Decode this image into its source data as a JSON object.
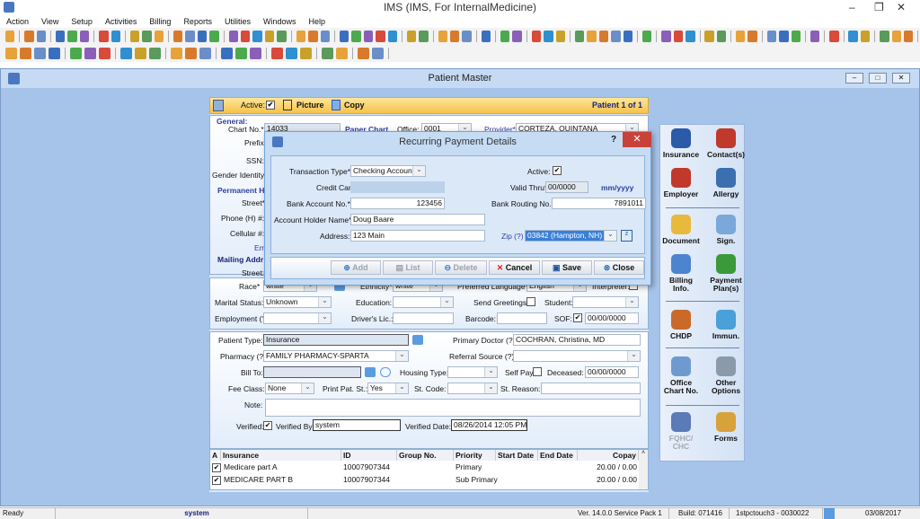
{
  "app": {
    "title": "IMS (IMS, For InternalMedicine)"
  },
  "menu": [
    "Action",
    "View",
    "Setup",
    "Activities",
    "Billing",
    "Reports",
    "Utilities",
    "Windows",
    "Help"
  ],
  "toolbar_colors": [
    "#e8a23a",
    "#d87a2c",
    "#6a8fc8",
    "#3a6fc0",
    "#4caa4c",
    "#8a5fb8",
    "#d84a3a",
    "#2f8fd0",
    "#c9a12a",
    "#5a9a5a"
  ],
  "window": {
    "title": "Patient Master"
  },
  "patient": {
    "active_label": "Active:",
    "active": true,
    "picture_label": "Picture",
    "copy_label": "Copy",
    "counter": "Patient 1 of 1",
    "general_label": "General:",
    "chart_no_label": "Chart No.*",
    "chart_no": "14033",
    "paper_chart_label": "Paper Chart",
    "office_label": "Office:",
    "office": "0001",
    "provider_label": "Provider*",
    "provider": "CORTEZA, QUINTANA",
    "prefix_label": "Prefix:",
    "ssn_label": "SSN:",
    "gender_identity_label": "Gender Identity:",
    "permanent_label": "Permanent H",
    "street_label": "Street*",
    "phone_label": "Phone (H) #:",
    "cellular_label": "Cellular #:",
    "email_label": "Email",
    "mailing_label": "Mailing Addr",
    "mailing_street_label": "Street:",
    "race_label": "Race*",
    "race": "white",
    "ethnicity_label": "Ethnicity*",
    "ethnicity": "white",
    "pref_lang_label": "Preferred Language*",
    "pref_lang": "English",
    "interpreter_label": "Interpreter:",
    "marital_label": "Marital Status:",
    "marital": "Unknown",
    "education_label": "Education:",
    "send_greetings_label": "Send Greetings:",
    "student_label": "Student:",
    "employment_label": "Employment (?)",
    "drivers_lic_label": "Driver's Lic.:",
    "barcode_label": "Barcode:",
    "sof_label": "SOF:",
    "sof_date": "00/00/0000",
    "patient_type_label": "Patient Type:",
    "patient_type": "Insurance",
    "primary_doctor_label": "Primary Doctor (?)",
    "primary_doctor": "COCHRAN, Christina, MD",
    "pharmacy_label": "Pharmacy (?)",
    "pharmacy": "FAMILY PHARMACY-SPARTA",
    "referral_label": "Referral Source (?)",
    "bill_to_label": "Bill To:",
    "housing_label": "Housing Type:",
    "self_pay_label": "Self Pay:",
    "deceased_label": "Deceased:",
    "deceased_date": "00/00/0000",
    "fee_class_label": "Fee Class:",
    "fee_class": "None",
    "print_pat_label": "Print Pat. St.:",
    "print_pat": "Yes",
    "st_code_label": "St. Code:",
    "st_reason_label": "St. Reason:",
    "note_label": "Note:",
    "verified_label": "Verified:",
    "verified_by_label": "Verified By:",
    "verified_by": "system",
    "verified_date_label": "Verified Date:",
    "verified_date": "08/26/2014 12:05 PM"
  },
  "insurance_grid": {
    "columns": [
      "A",
      "Insurance",
      "ID",
      "Group No.",
      "Priority",
      "Start Date",
      "End Date",
      "Copay"
    ],
    "rows": [
      {
        "active": true,
        "insurance": "Medicare part A",
        "id": "10007907344",
        "group": "",
        "priority": "Primary",
        "start": "",
        "end": "",
        "copay": "20.00 / 0.00"
      },
      {
        "active": true,
        "insurance": "MEDICARE PART B",
        "id": "10007907344",
        "group": "",
        "priority": "Sub Primary",
        "start": "",
        "end": "",
        "copay": "20.00 / 0.00"
      }
    ]
  },
  "side_panel": [
    {
      "label": "Insurance",
      "icon": "insurance-agent-icon",
      "color": "#2a5aa8"
    },
    {
      "label": "Contact(s)",
      "icon": "contacts-icon",
      "color": "#c0392b"
    },
    {
      "label": "Employer",
      "icon": "employer-icon",
      "color": "#c0392b"
    },
    {
      "label": "Allergy",
      "icon": "allergy-icon",
      "color": "#3a6fb0"
    },
    {
      "label": "Document",
      "icon": "document-folder-icon",
      "color": "#e7b93c"
    },
    {
      "label": "Sign.",
      "icon": "signature-icon",
      "color": "#7aa8d8"
    },
    {
      "label": "Billing Info.",
      "icon": "billing-info-icon",
      "color": "#4d84cf"
    },
    {
      "label": "Payment Plan(s)",
      "icon": "payment-plan-icon",
      "color": "#3a9a3a"
    },
    {
      "label": "CHDP",
      "icon": "chdp-icon",
      "color": "#c96a2a"
    },
    {
      "label": "Immun.",
      "icon": "syringe-icon",
      "color": "#4aa0d8"
    },
    {
      "label": "Office Chart No.",
      "icon": "office-chart-icon",
      "color": "#6f9ad0"
    },
    {
      "label": "Other Options",
      "icon": "gear-icon",
      "color": "#8a9aaa"
    },
    {
      "label": "FQHC/ CHC",
      "icon": "fqhc-icon",
      "color": "#5a7ab8"
    },
    {
      "label": "Forms",
      "icon": "forms-icon",
      "color": "#d8a23a"
    }
  ],
  "dialog": {
    "title": "Recurring Payment Details",
    "help": "?",
    "close": "✕",
    "transaction_type_label": "Transaction Type*",
    "transaction_type": "Checking Account",
    "active_label": "Active:",
    "active": true,
    "credit_card_label": "Credit Card No.*",
    "credit_card": "",
    "valid_thru_label": "Valid Thru*",
    "valid_thru": "00/0000",
    "valid_thru_format": "mm/yyyy",
    "bank_account_label": "Bank Account No.*",
    "bank_account": "123456",
    "bank_routing_label": "Bank Routing No.*",
    "bank_routing": "7891011",
    "holder_label": "Account Holder Name*",
    "holder": "Doug Baare",
    "address_label": "Address:",
    "address": "123 Main",
    "zip_label": "Zip (?)",
    "zip": "03842     (Hampton, NH)",
    "buttons": {
      "add": "Add",
      "list": "List",
      "delete": "Delete",
      "cancel": "Cancel",
      "save": "Save",
      "close": "Close"
    }
  },
  "status": {
    "state": "Ready",
    "user": "system",
    "version": "Ver. 14.0.0 Service Pack 1",
    "build": "Build: 071416",
    "station": "1stpctouch3 - 0030022",
    "date": "03/08/2017"
  }
}
